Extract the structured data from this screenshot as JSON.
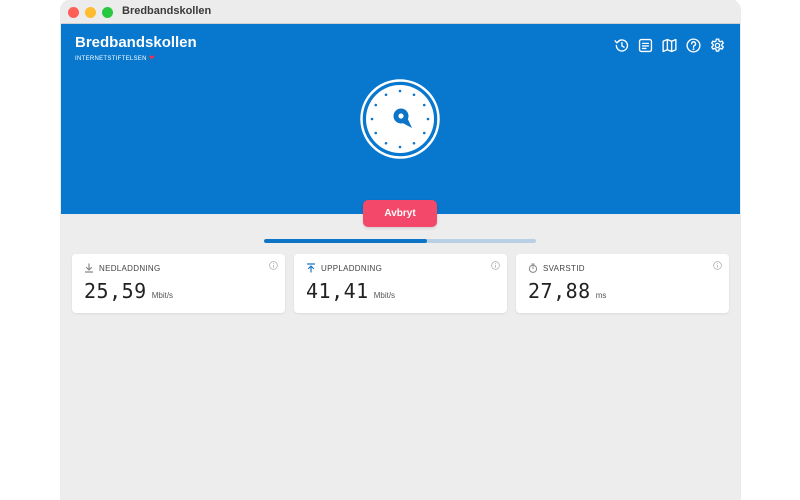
{
  "window": {
    "title": "Bredbandskollen"
  },
  "header": {
    "brand_title": "Bredbandskollen",
    "brand_subtitle": "INTERNETSTIFTELSEN",
    "heart_glyph": "❤"
  },
  "toolbar": {
    "icons": [
      "history-icon",
      "list-icon",
      "map-icon",
      "help-icon",
      "settings-icon"
    ]
  },
  "actions": {
    "cancel_label": "Avbryt"
  },
  "progress": {
    "fraction": 0.6
  },
  "metrics": {
    "download": {
      "label": "NEDLADDNING",
      "value": "25,59",
      "unit": "Mbit/s",
      "icon": "download-icon"
    },
    "upload": {
      "label": "UPPLADDNING",
      "value": "41,41",
      "unit": "Mbit/s",
      "icon": "upload-icon"
    },
    "latency": {
      "label": "SVARSTID",
      "value": "27,88",
      "unit": "ms",
      "icon": "stopwatch-icon"
    }
  },
  "colors": {
    "hero": "#0877ce",
    "cancel": "#f3486a",
    "progress_fill": "#0d74c6",
    "progress_track": "#b9cfe4",
    "upload_icon": "#1a78c8"
  }
}
